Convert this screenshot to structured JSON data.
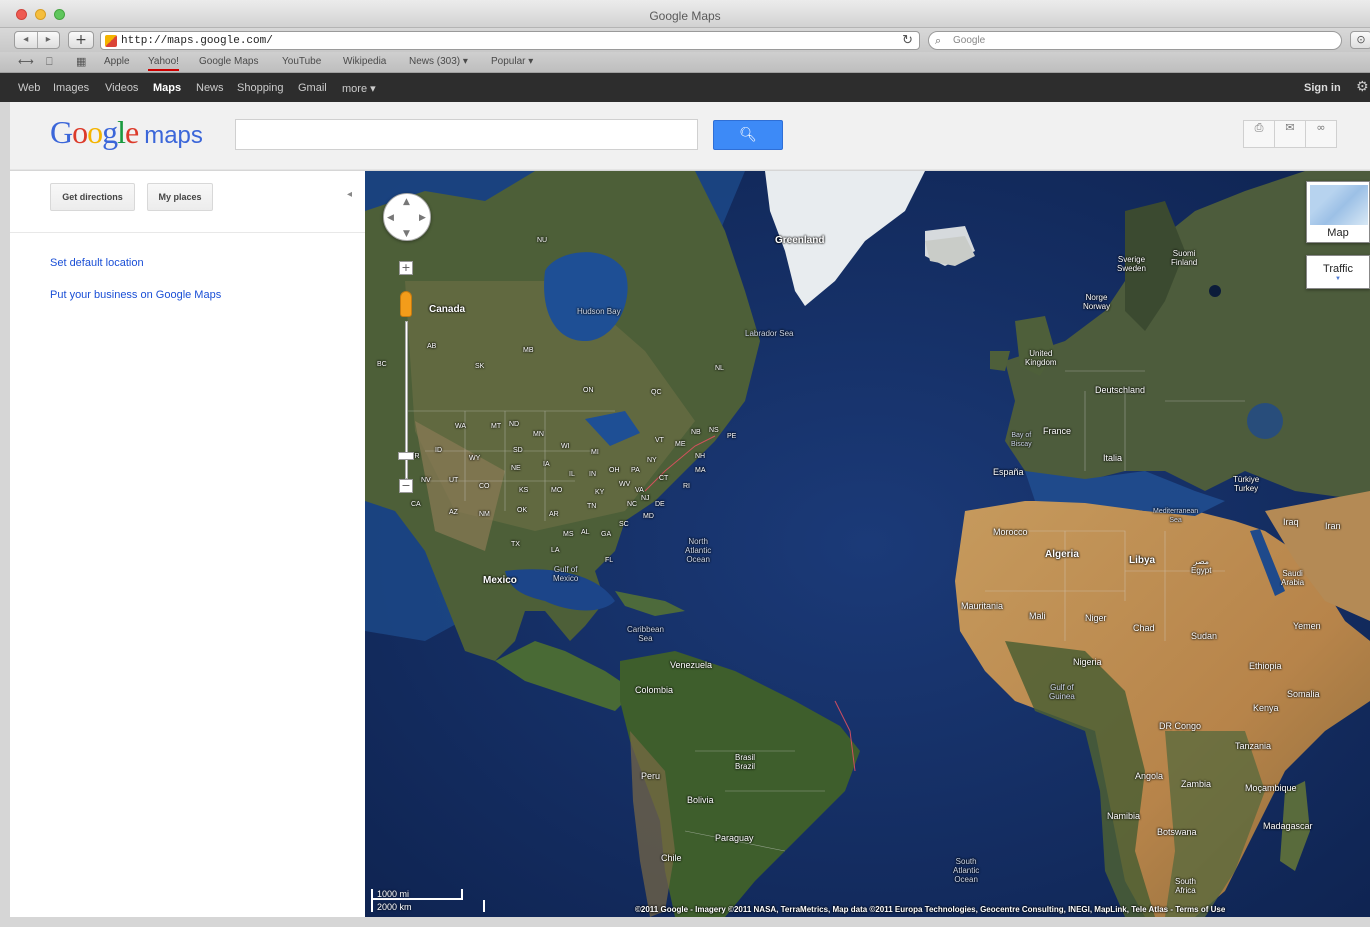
{
  "window": {
    "title": "Google Maps"
  },
  "toolbar": {
    "back": "◂",
    "forward": "▸",
    "new_tab": "+",
    "url": "http://maps.google.com/",
    "search_placeholder": "Google"
  },
  "bookmarks": [
    "Apple",
    "Yahoo!",
    "Google Maps",
    "YouTube",
    "Wikipedia",
    "News (303) ▾",
    "Popular ▾"
  ],
  "gbar": {
    "items": [
      "Web",
      "Images",
      "Videos",
      "Maps",
      "News",
      "Shopping",
      "Gmail",
      "more ▾"
    ],
    "active": "Maps",
    "sign_in": "Sign in"
  },
  "header": {
    "logo_letters": [
      "G",
      "o",
      "o",
      "g",
      "l",
      "e"
    ],
    "logo_suffix": "maps",
    "search_value": "",
    "tools": [
      "print",
      "email",
      "link"
    ]
  },
  "left_panel": {
    "get_directions": "Get directions",
    "my_places": "My places",
    "links": [
      "Set default location",
      "Put your business on Google Maps"
    ]
  },
  "map": {
    "view": "Satellite",
    "map_type_button": "Map",
    "traffic_button": "Traffic",
    "scale": {
      "imperial": "1000 mi",
      "metric": "2000 km"
    },
    "attribution": "©2011 Google - Imagery ©2011 NASA, TerraMetrics, Map data ©2011 Europa Technologies, Geocentre Consulting, INEGI, MapLink, Tele Atlas - Terms of Use",
    "labels": {
      "greenland": "Greenland",
      "canada": "Canada",
      "hudson_bay": "Hudson Bay",
      "labrador_sea": "Labrador Sea",
      "north_atlantic": "North\nAtlantic\nOcean",
      "mexico": "Mexico",
      "gulf_mexico": "Gulf of\nMexico",
      "caribbean": "Caribbean\nSea",
      "venezuela": "Venezuela",
      "colombia": "Colombia",
      "peru": "Peru",
      "brazil": "Brasil\nBrazil",
      "bolivia": "Bolivia",
      "paraguay": "Paraguay",
      "chile": "Chile",
      "south_atlantic": "South\nAtlantic\nOcean",
      "united_kingdom": "United\nKingdom",
      "france": "France",
      "espana": "España",
      "deutschland": "Deutschland",
      "sverige": "Sverige\nSweden",
      "suomi": "Suomi\nFinland",
      "norge": "Norge\nNorway",
      "italia": "Italia",
      "algeria": "Algeria",
      "libya": "Libya",
      "egypt": "مصر\nEgypt",
      "mali": "Mali",
      "niger": "Niger",
      "chad": "Chad",
      "sudan": "Sudan",
      "nigeria": "Nigeria",
      "ethiopia": "Ethiopia",
      "dr_congo": "DR Congo",
      "tanzania": "Tanzania",
      "angola": "Angola",
      "mocambique": "Moçambique",
      "madagascar": "Madagascar",
      "south_africa": "South\nAfrica",
      "saudi": "Saudi\nArabia",
      "iran": "Iran",
      "iraq": "Iraq",
      "turkey": "Türkiye\nTurkey",
      "morocco": "Morocco",
      "mauritania": "Mauritania",
      "kenya": "Kenya",
      "somalia": "Somalia",
      "yemen": "Yemen",
      "namibia": "Namibia",
      "botswana": "Botswana",
      "zambia": "Zambia",
      "gulf_guinea": "Gulf of\nGuinea",
      "mediterranean": "Mediterranean\nSea",
      "bay_biscay": "Bay of\nBiscay",
      "us_states": [
        "WA",
        "MT",
        "ND",
        "MN",
        "WI",
        "MI",
        "NY",
        "ME",
        "OR",
        "ID",
        "WY",
        "SD",
        "IA",
        "IL",
        "IN",
        "OH",
        "PA",
        "NV",
        "UT",
        "CO",
        "NE",
        "KS",
        "MO",
        "KY",
        "WV",
        "VA",
        "CA",
        "AZ",
        "NM",
        "OK",
        "AR",
        "TN",
        "NC",
        "SC",
        "GA",
        "AL",
        "MS",
        "LA",
        "TX",
        "FL",
        "VT",
        "NH",
        "MA",
        "CT",
        "NJ",
        "DE",
        "MD",
        "RI"
      ],
      "ca_prov": [
        "BC",
        "AB",
        "SK",
        "MB",
        "ON",
        "QC",
        "NU",
        "NL",
        "NS",
        "NB",
        "PE"
      ]
    }
  }
}
